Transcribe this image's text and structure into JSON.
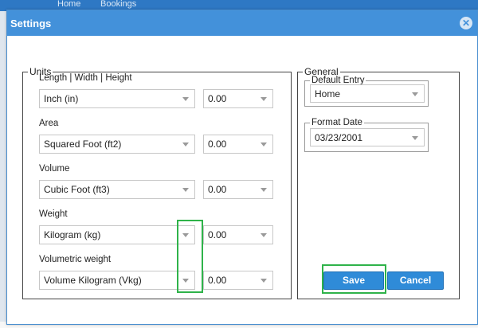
{
  "background": {
    "nav_tabs": [
      "Home",
      "Bookings"
    ]
  },
  "dialog": {
    "title": "Settings",
    "close_symbol": "✕"
  },
  "units": {
    "legend": "Units",
    "rows": [
      {
        "label": "Length | Width | Height",
        "unit": "Inch (in)",
        "precision": "0.00"
      },
      {
        "label": "Area",
        "unit": "Squared Foot (ft2)",
        "precision": "0.00"
      },
      {
        "label": "Volume",
        "unit": "Cubic Foot (ft3)",
        "precision": "0.00"
      },
      {
        "label": "Weight",
        "unit": "Kilogram (kg)",
        "precision": "0.00"
      },
      {
        "label": "Volumetric weight",
        "unit": "Volume Kilogram (Vkg)",
        "precision": "0.00"
      }
    ]
  },
  "general": {
    "legend": "General",
    "default_entry": {
      "legend": "Default Entry",
      "value": "Home"
    },
    "format_date": {
      "legend": "Format Date",
      "value": "03/23/2001"
    }
  },
  "actions": {
    "save_label": "Save",
    "cancel_label": "Cancel"
  },
  "colors": {
    "header": "#4391da",
    "button": "#2f8bd8",
    "highlight": "#2fb34a"
  }
}
